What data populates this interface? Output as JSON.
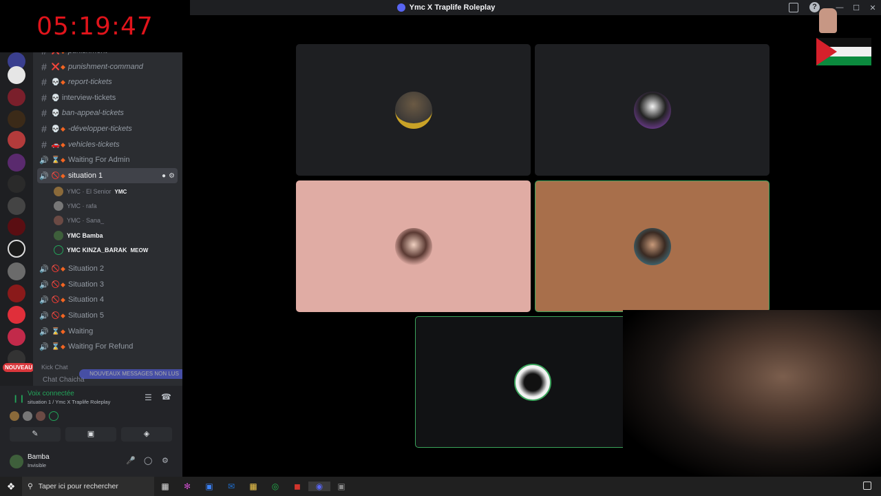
{
  "window": {
    "title": "Ymc X Traplife Roleplay"
  },
  "timer": "05:19:47",
  "channels": [
    {
      "name": "punishment",
      "emoji": "❌",
      "italic": true,
      "cut": true
    },
    {
      "name": "punishment-command",
      "emoji": "❌",
      "italic": true
    },
    {
      "name": "report-tickets",
      "emoji": "💀",
      "italic": true
    },
    {
      "name": "interview-tickets",
      "emoji": "💀",
      "italic": false
    },
    {
      "name": "ban-appeal-tickets",
      "emoji": "💀",
      "italic": true
    },
    {
      "name": "-développer-tickets",
      "emoji": "💀",
      "italic": true
    },
    {
      "name": "vehicles-tickets",
      "emoji": "🚗",
      "italic": true
    },
    {
      "name": "Waiting For Admin",
      "emoji": "⌛",
      "voice": true
    },
    {
      "name": "situation 1",
      "emoji": "🚫",
      "voice": true,
      "active": true
    }
  ],
  "members": [
    {
      "name": "YMC · El Senior",
      "badge": "YMC",
      "bright": false
    },
    {
      "name": "YMC · rafa",
      "bright": false
    },
    {
      "name": "YMC · Sana_",
      "bright": false
    },
    {
      "name": "YMC  Bamba",
      "bright": true
    },
    {
      "name": "YMC  KINZA_BARAK",
      "badge": "MEOW",
      "bright": true
    }
  ],
  "voice_channels": [
    {
      "name": "Situation 2",
      "emoji": "🚫"
    },
    {
      "name": "Situation 3",
      "emoji": "🚫"
    },
    {
      "name": "Situation 4",
      "emoji": "🚫"
    },
    {
      "name": "Situation 5",
      "emoji": "🚫"
    },
    {
      "name": "Waiting",
      "emoji": "⌛"
    },
    {
      "name": "Waiting For Refund",
      "emoji": "⌛"
    }
  ],
  "category": "Kick Chat",
  "new_messages": "NOUVEAUX MESSAGES NON LUS",
  "chat_channel": "Chat Chaicha",
  "rail_badge": "NOUVEAU",
  "voice": {
    "status": "Voix connectée",
    "location": "situation 1 / Ymc X Traplife Roleplay"
  },
  "user": {
    "name": "Bamba",
    "status": "Invisible"
  },
  "tiles": [
    {
      "bg": "#1e1f22",
      "avatar": "#c9a227",
      "border": "none"
    },
    {
      "bg": "#1e1f22",
      "avatar": "#6a3a8a",
      "border": "none"
    },
    {
      "bg": "#e0aca4",
      "avatar": "#5b3a33",
      "border": "none"
    },
    {
      "bg": "#a86f4b",
      "avatar": "#3d6c7a",
      "border": "#3ba55c"
    },
    {
      "bg": "#111214",
      "avatar": "#f2f2f2",
      "border": "#3ba55c"
    }
  ],
  "taskbar": {
    "search_placeholder": "Taper ici pour rechercher"
  },
  "colors": {
    "accent": "#5865f2",
    "speaking": "#3ba55c",
    "timer": "#e0141b"
  }
}
